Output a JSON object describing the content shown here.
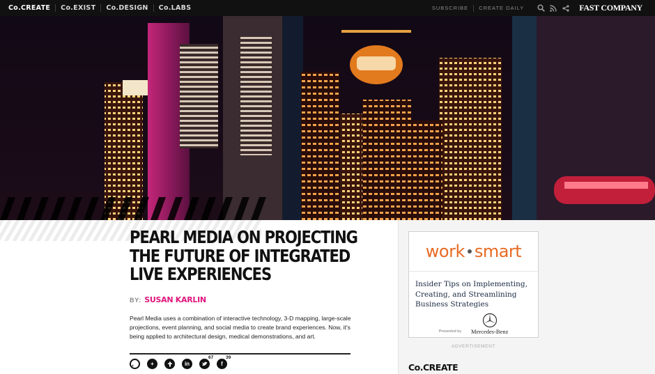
{
  "topnav": {
    "sites": [
      "Co.CREATE",
      "Co.EXIST",
      "Co.DESIGN",
      "Co.LABS"
    ],
    "links": [
      "SUBSCRIBE",
      "CREATE DAILY"
    ],
    "icons": [
      "search-icon",
      "rss-icon",
      "share-icon"
    ],
    "logo": "FAST COMPANY"
  },
  "hero": {
    "image": "projection-mapping-cityscape-night"
  },
  "article": {
    "headline": "PEARL MEDIA ON PROJECTING THE FUTURE OF INTEGRATED LIVE EXPERIENCES",
    "by_label": "BY:",
    "author": "SUSAN KARLIN",
    "deck": "Pearl Media uses a combination of interactive technology, 3-D mapping, large-scale projections, event planning, and social media to create brand experiences. Now, it's being applied to architectural design, medical demonstrations, and art.",
    "shares": [
      {
        "icon": "comment-icon",
        "count": ""
      },
      {
        "icon": "add-icon",
        "count": ""
      },
      {
        "icon": "stumbleupon-icon",
        "count": ""
      },
      {
        "icon": "linkedin-icon",
        "count": ""
      },
      {
        "icon": "twitter-icon",
        "count": "67"
      },
      {
        "icon": "facebook-icon",
        "count": "39"
      }
    ]
  },
  "sidebar": {
    "ad": {
      "brand_left": "work",
      "brand_right": "smart",
      "tagline": "Insider Tips on Implementing, Creating, and Streamlining Business Strategies",
      "presented_by": "Presented by",
      "sponsor": "Mercedes-Benz"
    },
    "ad_label": "ADVERTISEMENT",
    "section_title": "Co.CREATE"
  },
  "colors": {
    "accent_author": "#e0157d",
    "ad_brand": "#e76a23",
    "nav_bg": "#111111"
  }
}
